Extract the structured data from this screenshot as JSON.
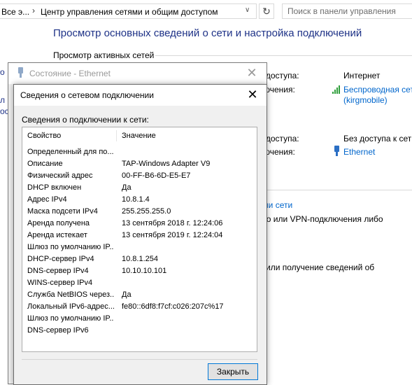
{
  "address_bar": {
    "segment1": "Все э...",
    "separator": "›",
    "segment2": "Центр управления сетями и общим доступом",
    "dropdown_glyph": "∨",
    "refresh_glyph": "↻",
    "search_placeholder": "Поиск в панели управления"
  },
  "control_panel": {
    "title": "Просмотр основных сведений о сети и настройка подключений",
    "active_networks_label": "Просмотр активных сетей",
    "network1": {
      "access_type_label": "п доступа:",
      "access_type_value": "Интернет",
      "connections_label": "лючения:",
      "connection_name": "Беспроводная сет",
      "connection_ssid": "(kirgmobile)"
    },
    "network2": {
      "access_type_label": "п доступа:",
      "access_type_value": "Без доступа к сети",
      "connections_label": "лючения:",
      "connection_name": "Ethernet"
    },
    "fragment_link": "али сети",
    "fragment_text1": "ого или VPN-подключения либо",
    "fragment_text2": "о или получение сведений об",
    "left_fragments": [
      "о",
      "л",
      "ос"
    ]
  },
  "status_window": {
    "title": "Состояние - Ethernet",
    "close_glyph": "✕"
  },
  "details_dialog": {
    "title": "Сведения о сетевом подключении",
    "close_glyph": "✕",
    "caption": "Сведения о подключении к сети:",
    "col_property": "Свойство",
    "col_value": "Значение",
    "rows": [
      {
        "property": "Определенный для по...",
        "value": ""
      },
      {
        "property": "Описание",
        "value": "TAP-Windows Adapter V9"
      },
      {
        "property": "Физический адрес",
        "value": "00-FF-B6-6D-E5-E7"
      },
      {
        "property": "DHCP включен",
        "value": "Да"
      },
      {
        "property": "Адрес IPv4",
        "value": "10.8.1.4"
      },
      {
        "property": "Маска подсети IPv4",
        "value": "255.255.255.0"
      },
      {
        "property": "Аренда получена",
        "value": "13 сентября 2018 г. 12:24:06"
      },
      {
        "property": "Аренда истекает",
        "value": "13 сентября 2019 г. 12:24:04"
      },
      {
        "property": "Шлюз по умолчанию IP...",
        "value": ""
      },
      {
        "property": "DHCP-сервер IPv4",
        "value": "10.8.1.254"
      },
      {
        "property": "DNS-сервер IPv4",
        "value": "10.10.10.101"
      },
      {
        "property": "WINS-сервер IPv4",
        "value": ""
      },
      {
        "property": "Служба NetBIOS через...",
        "value": "Да"
      },
      {
        "property": "Локальный IPv6-адрес...",
        "value": "fe80::6df8:f7cf:c026:207c%17"
      },
      {
        "property": "Шлюз по умолчанию IP...",
        "value": ""
      },
      {
        "property": "DNS-сервер IPv6",
        "value": ""
      }
    ],
    "close_button": "Закрыть"
  },
  "colors": {
    "title_blue": "#1e3287",
    "link_blue": "#0066cc",
    "button_border": "#0078d7"
  }
}
